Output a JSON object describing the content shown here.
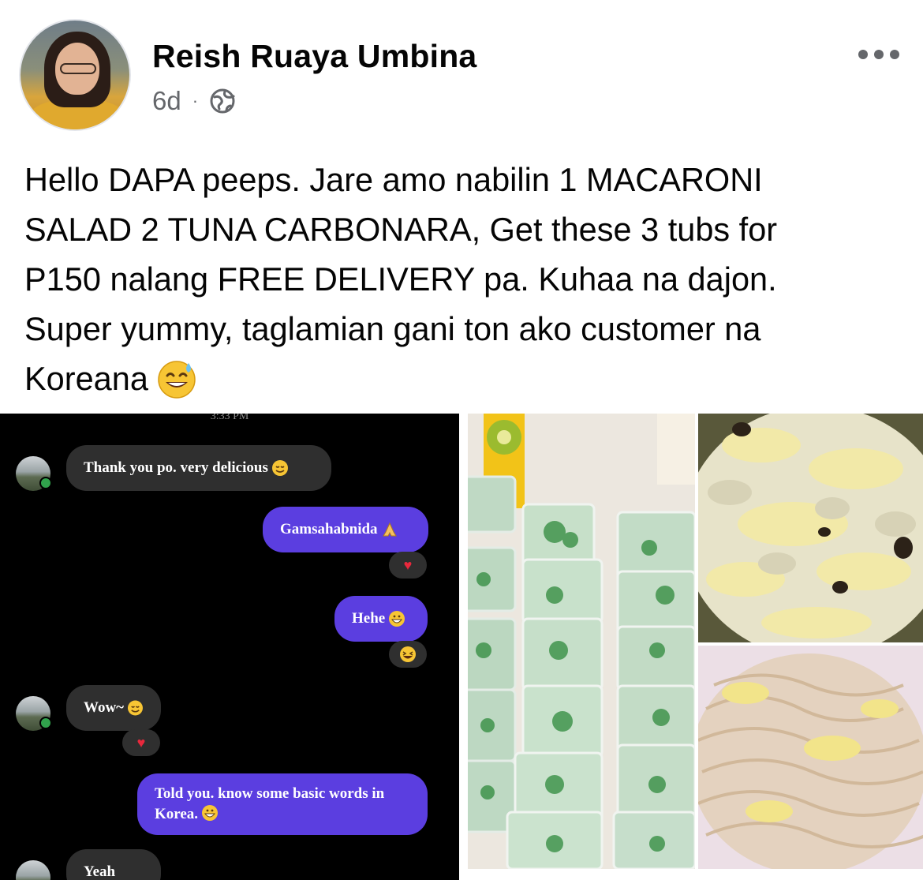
{
  "post": {
    "author": "Reish Ruaya Umbina",
    "time": "6d",
    "separator": "·",
    "privacy_icon": "globe-icon",
    "more_icon": "more-options-icon",
    "text": "Hello DAPA peeps. Jare amo nabilin 1 MACARONI\nSALAD 2 TUNA CARBONARA, Get these 3 tubs for\nP150 nalang FREE DELIVERY pa. Kuhaa na dajon.\nSuper yummy, taglamian gani ton ako customer na\nKoreana",
    "text_emoji": "grinning-sweat-emoji"
  },
  "chat_screenshot": {
    "timestamp": "3:33 PM",
    "messages": [
      {
        "side": "in",
        "text": "Thank you po. very delicious",
        "emoji": "smiling-face-emoji"
      },
      {
        "side": "out",
        "text": "Gamsahabnida",
        "emoji": "folded-hands-emoji",
        "reaction": "heart"
      },
      {
        "side": "out",
        "text": "Hehe",
        "emoji": "grinning-emoji",
        "reaction": "laughing-emoji"
      },
      {
        "side": "in",
        "text": "Wow~",
        "emoji": "smiling-face-emoji",
        "reaction": "heart"
      },
      {
        "side": "out",
        "text": "Told you. know some basic words in Korea.",
        "emoji": "grinning-emoji"
      }
    ],
    "partial_last": "Yeah",
    "heart_glyph": "♥"
  },
  "photos": [
    {
      "name": "buko-pandan-tubs-photo"
    },
    {
      "name": "macaroni-salad-photo"
    },
    {
      "name": "tuna-carbonara-photo"
    }
  ],
  "colors": {
    "outgoing_bubble": "#5b3ee0",
    "incoming_bubble": "#2f2f2f",
    "meta_text": "#65676b"
  }
}
